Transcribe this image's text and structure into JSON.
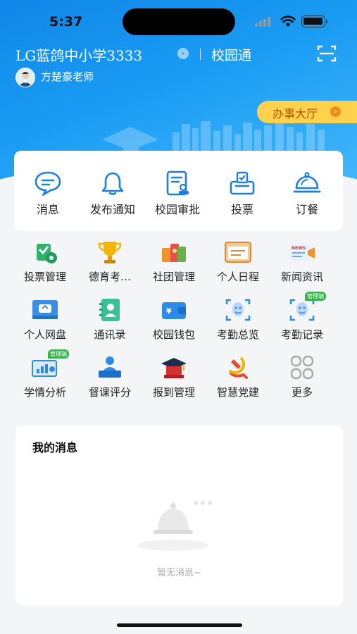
{
  "status_bar": {
    "time": "5:37"
  },
  "header": {
    "school_name": "LG蓝鸽中小学3333",
    "chevron": "›",
    "app_name": "校园通",
    "teacher_name": "方楚豪老师",
    "service_hall": "办事大厅",
    "service_arrow": "›"
  },
  "quick_actions": [
    {
      "label": "消息",
      "icon": "message-icon"
    },
    {
      "label": "发布通知",
      "icon": "bell-icon"
    },
    {
      "label": "校园审批",
      "icon": "approval-icon"
    },
    {
      "label": "投票",
      "icon": "vote-box-icon"
    },
    {
      "label": "订餐",
      "icon": "food-cloche-icon"
    }
  ],
  "apps": [
    {
      "label": "投票管理",
      "icon": "vote-manage-icon"
    },
    {
      "label": "德育考…",
      "icon": "trophy-icon"
    },
    {
      "label": "社团管理",
      "icon": "club-icon"
    },
    {
      "label": "个人日程",
      "icon": "schedule-icon"
    },
    {
      "label": "新闻资讯",
      "icon": "news-icon"
    },
    {
      "label": "个人网盘",
      "icon": "cloud-drive-icon"
    },
    {
      "label": "通讯录",
      "icon": "contacts-icon"
    },
    {
      "label": "校园钱包",
      "icon": "wallet-icon"
    },
    {
      "label": "考勤总览",
      "icon": "face-scan-icon"
    },
    {
      "label": "考勤记录",
      "icon": "face-record-icon",
      "badge": "管理端"
    },
    {
      "label": "学情分析",
      "icon": "analysis-icon",
      "badge": "管理端"
    },
    {
      "label": "督课评分",
      "icon": "lecture-icon"
    },
    {
      "label": "报到管理",
      "icon": "graduation-icon"
    },
    {
      "label": "智慧党建",
      "icon": "party-icon"
    },
    {
      "label": "更多",
      "icon": "more-icon"
    }
  ],
  "messages": {
    "title": "我的消息",
    "empty_text": "暂无消息~"
  },
  "colors": {
    "primary": "#1a8fe8",
    "accent": "#ffd24d",
    "badge": "#37b24d"
  }
}
